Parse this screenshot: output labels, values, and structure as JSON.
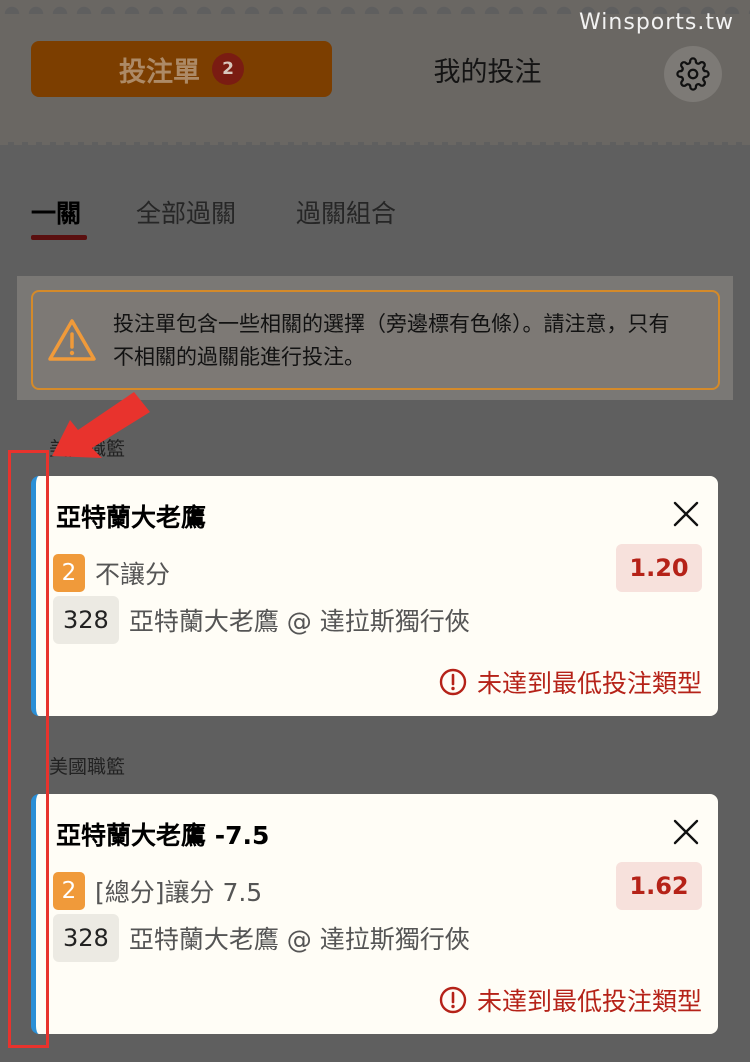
{
  "watermark": "Winsports.tw",
  "header": {
    "betslip_label": "投注單",
    "betslip_count": "2",
    "mybets_label": "我的投注",
    "settings_icon": "gear-icon"
  },
  "subtabs": [
    "一關",
    "全部過關",
    "過關組合"
  ],
  "warning": {
    "icon": "warning-triangle-icon",
    "text": "投注單包含一些相關的選擇（旁邊標有色條）。請注意，只有不相關的過關能進行投注。"
  },
  "bets": [
    {
      "league": "美國職籃",
      "title": "亞特蘭大老鷹",
      "number": "2",
      "market": "不讓分",
      "odds": "1.20",
      "match_id": "328",
      "match": "亞特蘭大老鷹 @ 達拉斯獨行俠",
      "error": "未達到最低投注類型"
    },
    {
      "league": "美國職籃",
      "title": "亞特蘭大老鷹 -7.5",
      "number": "2",
      "market": "[總分]讓分 7.5",
      "odds": "1.62",
      "match_id": "328",
      "match": "亞特蘭大老鷹 @ 達拉斯獨行俠",
      "error": "未達到最低投注類型"
    }
  ],
  "colors": {
    "accent": "#7c3e00",
    "correlated_bar": "#2b8fd6",
    "error": "#b52218",
    "highlight": "#e8332d"
  }
}
